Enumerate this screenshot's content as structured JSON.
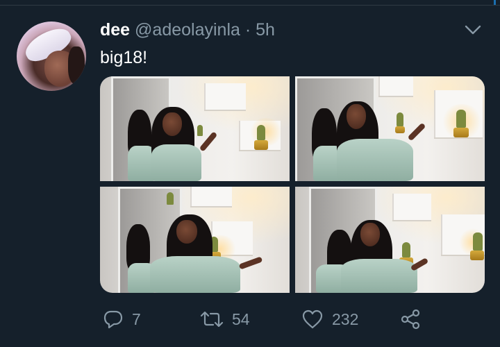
{
  "tweet": {
    "display_name": "dee",
    "handle": "@adeolayinla",
    "separator": "·",
    "time": "5h",
    "text": "big18!"
  },
  "media": {
    "count": 4,
    "subject": "woman in mint satin outfit posing beside white illuminated shelves with potted cacti and a mirror"
  },
  "actions": {
    "reply": {
      "icon": "reply-icon",
      "count": "7"
    },
    "retweet": {
      "icon": "retweet-icon",
      "count": "54"
    },
    "like": {
      "icon": "heart-icon",
      "count": "232"
    },
    "share": {
      "icon": "share-icon"
    }
  },
  "colors": {
    "background": "#15202b",
    "text": "#ffffff",
    "secondary": "#8899a6",
    "divider": "#2f3a44"
  }
}
